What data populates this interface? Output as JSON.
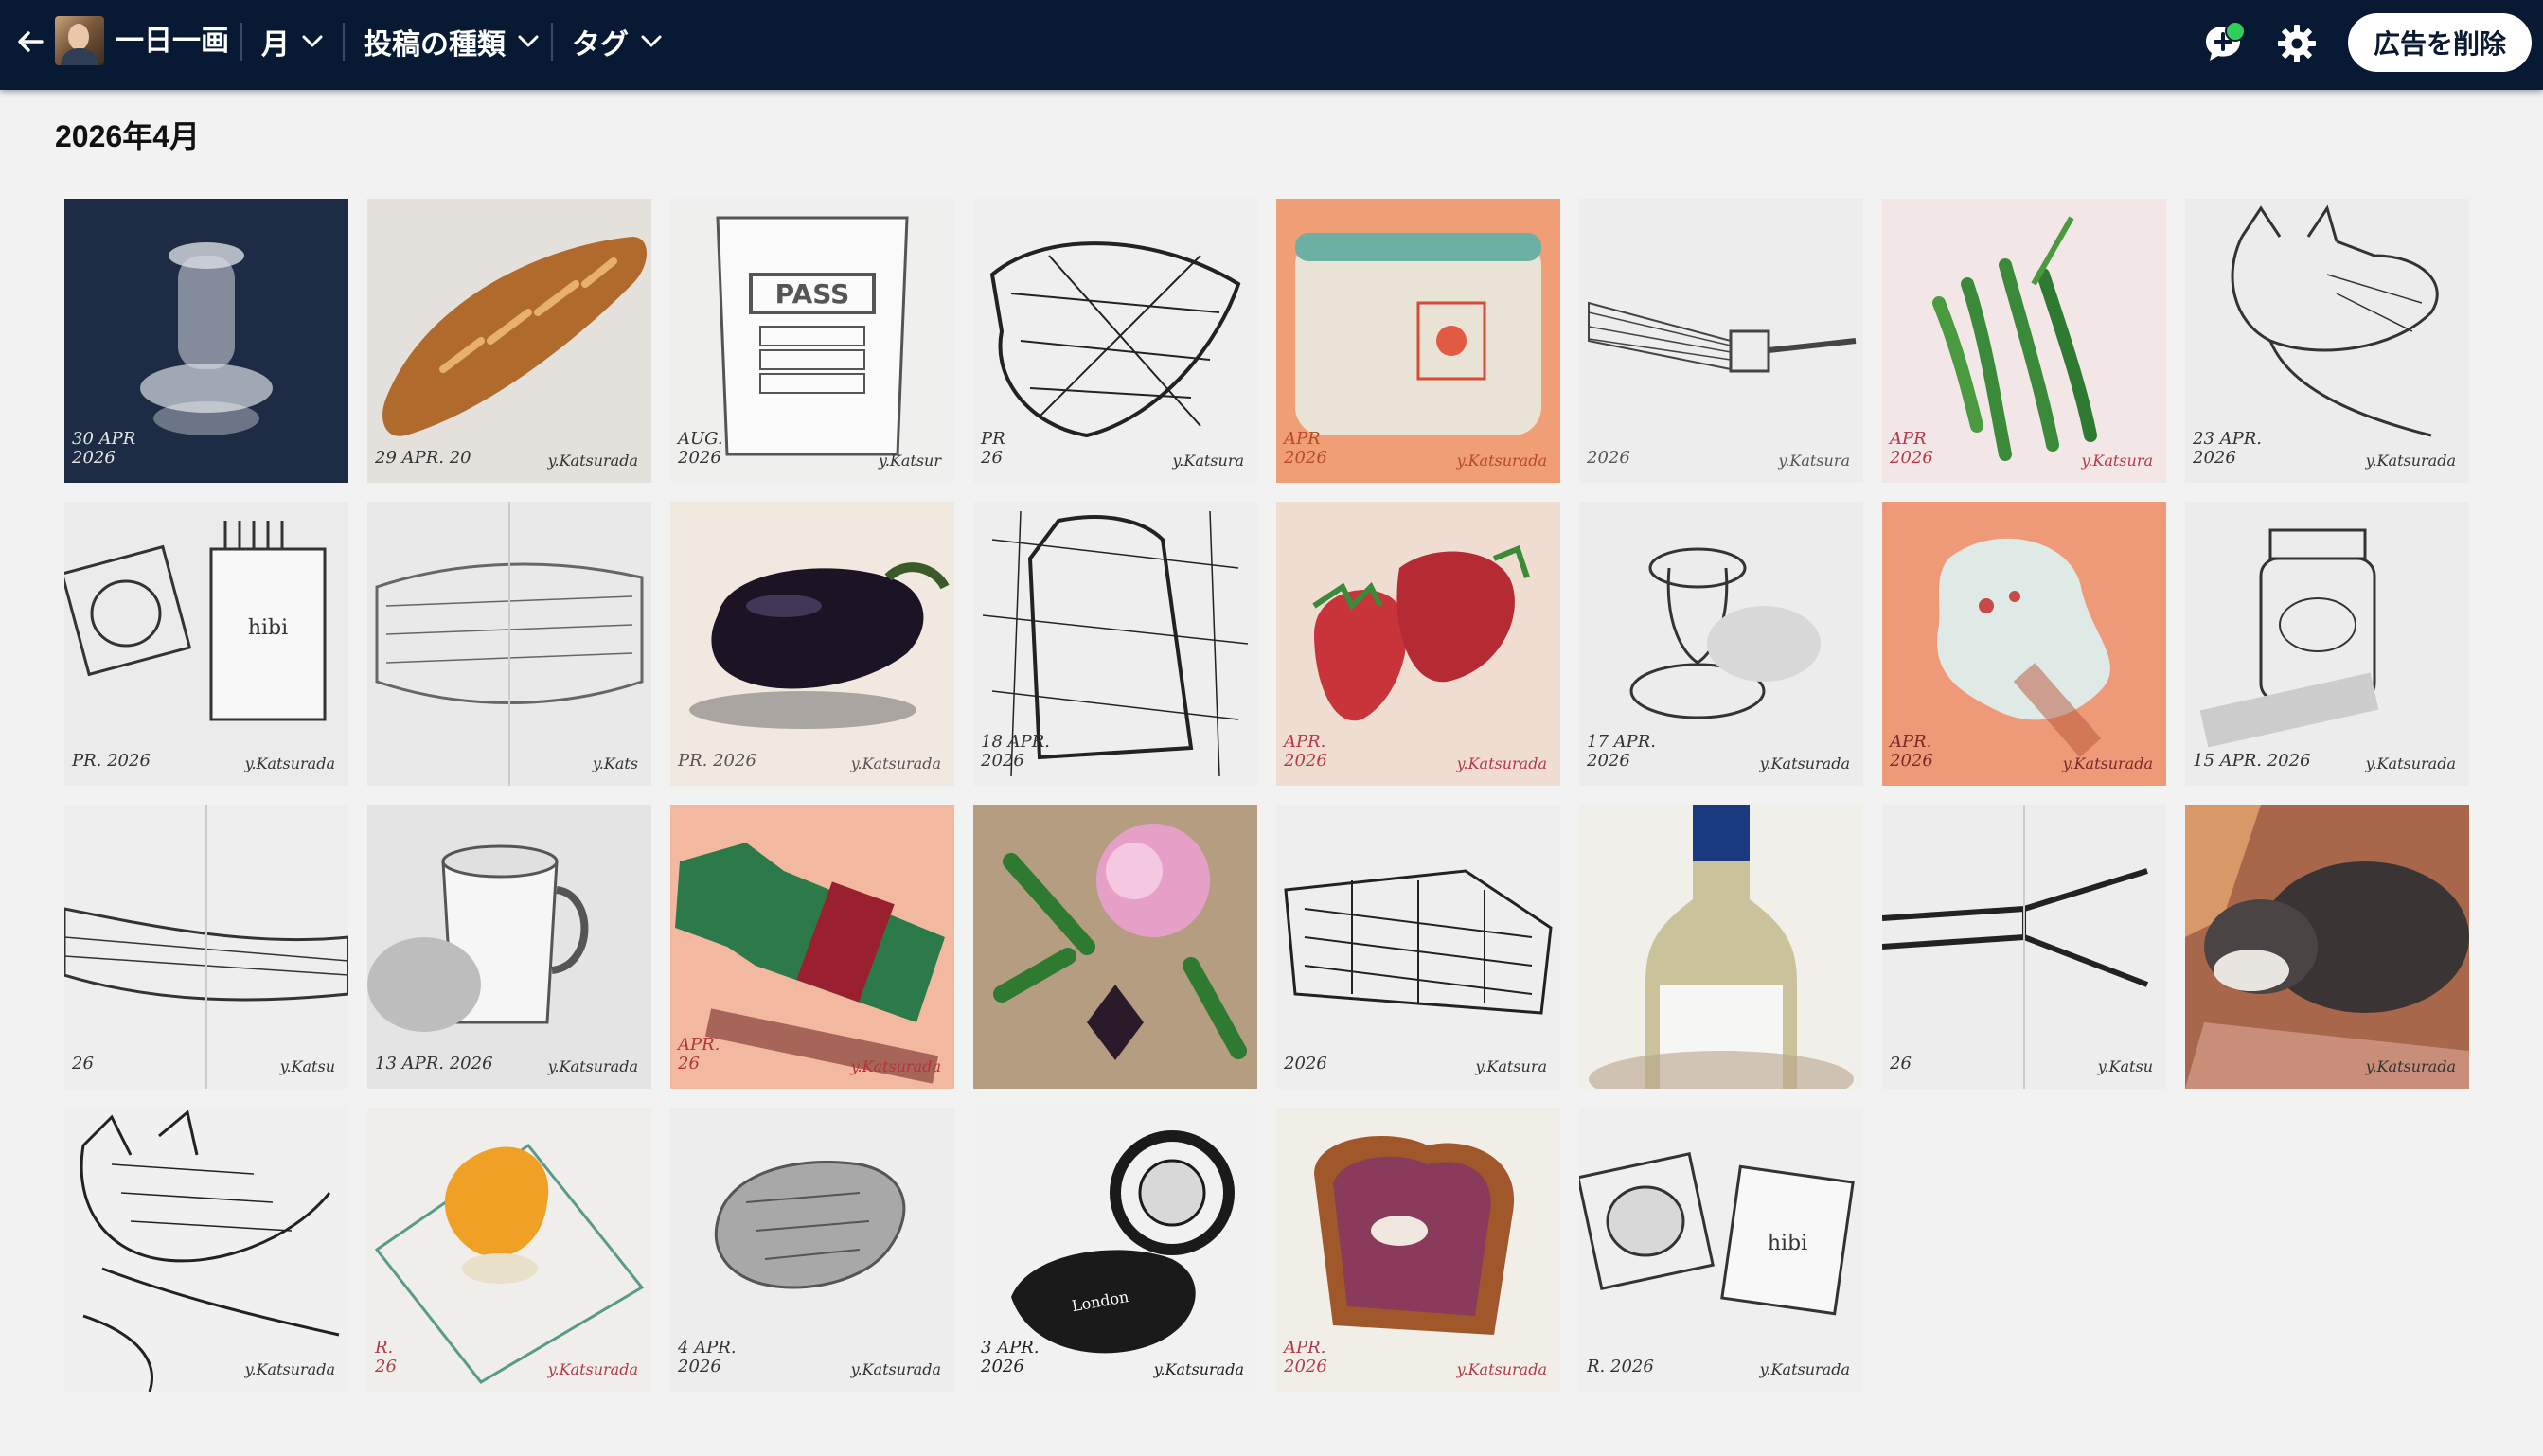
{
  "header": {
    "app_title": "一日一画",
    "month_menu": "月",
    "post_type_menu": "投稿の種類",
    "tag_menu": "タグ",
    "remove_ads_label": "広告を削除",
    "icons": {
      "back": "back-arrow-icon",
      "add_comment": "add-comment-icon",
      "settings": "gear-icon",
      "chevron": "chevron-down-icon"
    },
    "colors": {
      "bar": "#081a33",
      "notification_dot": "#2fd05a"
    }
  },
  "section": {
    "month_heading": "2026年4月"
  },
  "gallery": [
    {
      "subject": "glass candlestick",
      "bg": "#1d2c44",
      "fg": "#d8dde4",
      "shape": "candlestick",
      "date": "30 APR\n2026",
      "date_color": "#e6e6e6",
      "sig": ""
    },
    {
      "subject": "baguette",
      "bg": "#e4e1dc",
      "fg": "#b06a2c",
      "shape": "baguette",
      "date": "29 APR. 20",
      "date_color": "#333",
      "sig": "y.Katsurada"
    },
    {
      "subject": "coffee bag",
      "bg": "#efefee",
      "fg": "#555",
      "shape": "bag",
      "date": "AUG.\n2026",
      "date_color": "#333",
      "sig": "y.Katsur"
    },
    {
      "subject": "crumpled bag",
      "bg": "#efefef",
      "fg": "#222",
      "shape": "scribble",
      "date": "PR\n26",
      "date_color": "#333",
      "sig": "y.Katsura"
    },
    {
      "subject": "pouch",
      "bg": "#ef9e76",
      "fg": "#e9e3d6",
      "shape": "pouch",
      "date": "APR\n2026",
      "date_color": "#b84a2a",
      "sig": "y.Katsurada"
    },
    {
      "subject": "broom",
      "bg": "#ededed",
      "fg": "#444",
      "shape": "broom",
      "date": "2026",
      "date_color": "#555",
      "sig": "y.Katsura"
    },
    {
      "subject": "green beans",
      "bg": "#f3e6e6",
      "fg": "#3a8a3a",
      "shape": "beans",
      "date": "APR\n2026",
      "date_color": "#b43a4a",
      "sig": "y.Katsura"
    },
    {
      "subject": "cat sketch",
      "bg": "#ececec",
      "fg": "#333",
      "shape": "cat",
      "date": "23 APR.\n2026",
      "date_color": "#333",
      "sig": "y.Katsurada"
    },
    {
      "subject": "ashtray and matches",
      "bg": "#ebebeb",
      "fg": "#333",
      "shape": "matches",
      "date": "PR. 2026",
      "date_color": "#333",
      "sig": "y.Katsurada"
    },
    {
      "subject": "bread roll sketch",
      "bg": "#e9e9e9",
      "fg": "#666",
      "shape": "roll",
      "date": "",
      "date_color": "#333",
      "sig": "y.Kats"
    },
    {
      "subject": "eggplant",
      "bg": "#f1e8df",
      "fg": "#1c1424",
      "shape": "eggplant",
      "date": "PR. 2026",
      "date_color": "#555",
      "sig": "y.Katsurada"
    },
    {
      "subject": "paper bag",
      "bg": "#eeeeee",
      "fg": "#222",
      "shape": "paperbag",
      "date": "18 APR.\n2026",
      "date_color": "#333",
      "sig": ""
    },
    {
      "subject": "strawberries",
      "bg": "#f0ddd2",
      "fg": "#c8343a",
      "shape": "strawberry",
      "date": "APR.\n2026",
      "date_color": "#b43a4a",
      "sig": "y.Katsurada"
    },
    {
      "subject": "glass candlestick sketch",
      "bg": "#ececec",
      "fg": "#333",
      "shape": "candlesketch",
      "date": "17 APR.\n2026",
      "date_color": "#333",
      "sig": "y.Katsurada"
    },
    {
      "subject": "porcelain",
      "bg": "#ee9a78",
      "fg": "#dfe9e6",
      "shape": "porcelain",
      "date": "APR.\n2026",
      "date_color": "#7a2a2a",
      "sig": "y.Katsurada"
    },
    {
      "subject": "jam jar",
      "bg": "#ececec",
      "fg": "#333",
      "shape": "jar",
      "date": "15 APR. 2026",
      "date_color": "#333",
      "sig": "y.Katsurada"
    },
    {
      "subject": "long loaf",
      "bg": "#eeeeee",
      "fg": "#333",
      "shape": "longloaf",
      "date": "26",
      "date_color": "#333",
      "sig": "y.Katsu"
    },
    {
      "subject": "mug",
      "bg": "#e4e4e4",
      "fg": "#555",
      "shape": "mug",
      "date": "13 APR. 2026",
      "date_color": "#333",
      "sig": "y.Katsurada"
    },
    {
      "subject": "sparkling bottle",
      "bg": "#f3b9a0",
      "fg": "#2c7a4a",
      "shape": "bottle",
      "date": "APR.\n26",
      "date_color": "#b4343a",
      "sig": "y.Katsurada"
    },
    {
      "subject": "peony",
      "bg": "#f09a88",
      "fg": "#e6a0c8",
      "shape": "peony",
      "date": "",
      "date_color": "#333",
      "sig": ""
    },
    {
      "subject": "crumpled sack",
      "bg": "#eeeeee",
      "fg": "#222",
      "shape": "sack",
      "date": "2026",
      "date_color": "#333",
      "sig": "y.Katsura"
    },
    {
      "subject": "wine bottle",
      "bg": "#f0efe9",
      "fg": "#c9c29a",
      "shape": "wine",
      "date": "",
      "date_color": "#333",
      "sig": ""
    },
    {
      "subject": "tongs",
      "bg": "#ededed",
      "fg": "#222",
      "shape": "tongs",
      "date": "26",
      "date_color": "#333",
      "sig": "y.Katsu"
    },
    {
      "subject": "sleeping cat",
      "bg": "#a8664a",
      "fg": "#3a3434",
      "shape": "sleepcat",
      "date": "",
      "date_color": "#333",
      "sig": "y.Katsurada"
    },
    {
      "subject": "cat sleeping sketch",
      "bg": "#f0f0f0",
      "fg": "#222",
      "shape": "catsketch",
      "date": "",
      "date_color": "#333",
      "sig": "y.Katsurada"
    },
    {
      "subject": "marmalade on glass",
      "bg": "#f0eeeb",
      "fg": "#f0a024",
      "shape": "marmalade",
      "date": "R.\n26",
      "date_color": "#b43a4a",
      "sig": "y.Katsurada"
    },
    {
      "subject": "stone",
      "bg": "#ededed",
      "fg": "#555",
      "shape": "stone",
      "date": "4 APR.\n2026",
      "date_color": "#333",
      "sig": "y.Katsurada"
    },
    {
      "subject": "tape measure",
      "bg": "#f1f1f1",
      "fg": "#1a1a1a",
      "shape": "tape",
      "date": "3 APR.\n2026",
      "date_color": "#222",
      "sig": "y.Katsurada"
    },
    {
      "subject": "toast with jam",
      "bg": "#f1eee8",
      "fg": "#8a3a5a",
      "shape": "toast",
      "date": "APR.\n2026",
      "date_color": "#b43a4a",
      "sig": "y.Katsurada"
    },
    {
      "subject": "ashtray and hibi",
      "bg": "#efefef",
      "fg": "#333",
      "shape": "hibi",
      "date": "R. 2026",
      "date_color": "#333",
      "sig": "y.Katsurada"
    }
  ]
}
